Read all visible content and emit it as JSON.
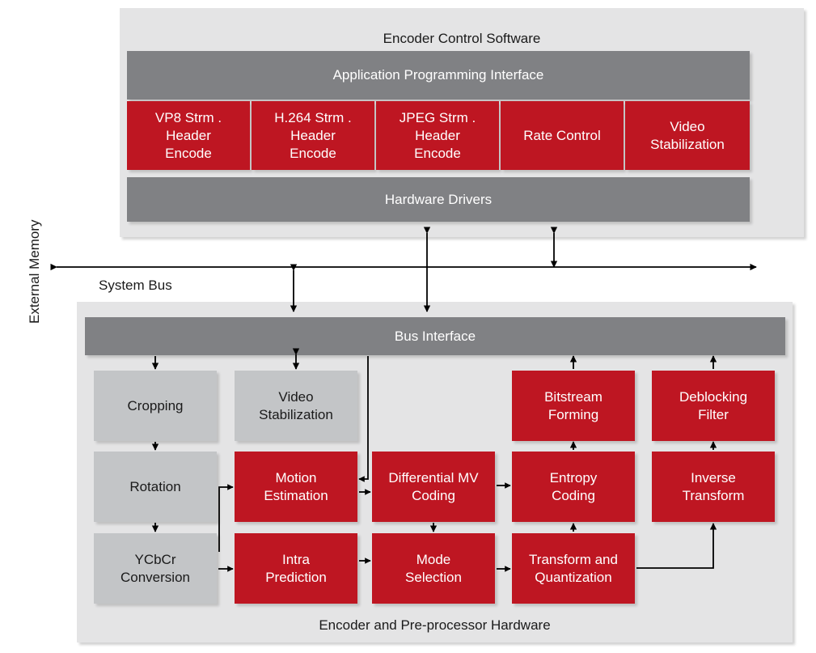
{
  "colors": {
    "red": "#be1622",
    "gray_dark": "#808184",
    "gray_light": "#c3c5c7",
    "panel_bg": "#e4e4e5",
    "text_dark": "#1a1a1a",
    "text_light": "#ffffff",
    "arrow": "#000000",
    "page_bg": "#ffffff"
  },
  "labels": {
    "external_memory": "External Memory",
    "system_bus": "System Bus"
  },
  "software_panel": {
    "title": "Encoder Control Software",
    "api_bar": "Application Programming Interface",
    "drivers_bar": "Hardware Drivers",
    "modules": [
      {
        "label": "VP8 Strm .\nHeader\nEncode"
      },
      {
        "label": "H.264 Strm .\nHeader\nEncode"
      },
      {
        "label": "JPEG Strm .\nHeader\nEncode"
      },
      {
        "label": "Rate Control"
      },
      {
        "label": "Video\nStabilization"
      }
    ]
  },
  "hardware_panel": {
    "title": "Encoder and Pre-processor Hardware",
    "bus_interface": "Bus Interface",
    "blocks": [
      {
        "label": "Cropping",
        "kind": "gray"
      },
      {
        "label": "Video\nStabilization",
        "kind": "gray"
      },
      {
        "label": "Bitstream\nForming",
        "kind": "red"
      },
      {
        "label": "Deblocking\nFilter",
        "kind": "red"
      },
      {
        "label": "Rotation",
        "kind": "gray"
      },
      {
        "label": "Motion\nEstimation",
        "kind": "red"
      },
      {
        "label": "Differential MV\nCoding",
        "kind": "red"
      },
      {
        "label": "Entropy\nCoding",
        "kind": "red"
      },
      {
        "label": "Inverse\nTransform",
        "kind": "red"
      },
      {
        "label": "YCbCr\nConversion",
        "kind": "gray"
      },
      {
        "label": "Intra\nPrediction",
        "kind": "red"
      },
      {
        "label": "Mode\nSelection",
        "kind": "red"
      },
      {
        "label": "Transform and\nQuantization",
        "kind": "red"
      }
    ]
  }
}
